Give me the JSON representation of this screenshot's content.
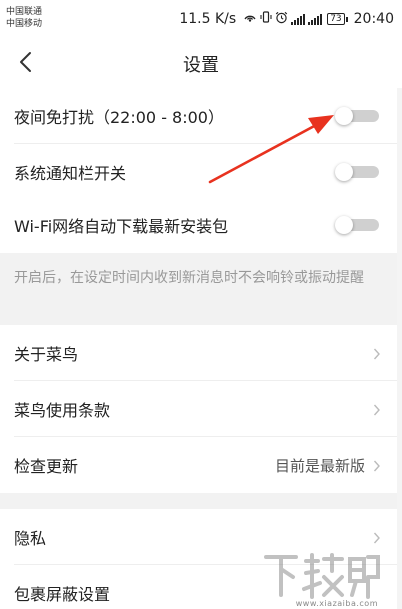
{
  "status_bar": {
    "carrier_1": "中国联通",
    "carrier_2": "中国移动",
    "net_speed": "11.5 K/s",
    "battery": "73",
    "time": "20:40",
    "icons": [
      "hotspot-icon",
      "vibrate-icon",
      "alarm-icon",
      "signal-icon",
      "signal-icon",
      "battery-icon"
    ]
  },
  "nav": {
    "title": "设置",
    "back_icon": "chevron-left-icon"
  },
  "toggles": [
    {
      "label": "夜间免打扰（22:00 - 8:00）",
      "on": false
    },
    {
      "label": "系统通知栏开关",
      "on": false
    },
    {
      "label": "Wi-Fi网络自动下载最新安装包",
      "on": false
    }
  ],
  "note": "开启后，在设定时间内收到新消息时不会响铃或振动提醒",
  "links": [
    {
      "label": "关于菜鸟",
      "value": ""
    },
    {
      "label": "菜鸟使用条款",
      "value": ""
    },
    {
      "label": "检查更新",
      "value": "目前是最新版"
    },
    {
      "label": "隐私",
      "value": ""
    },
    {
      "label": "包裹屏蔽设置",
      "value": ""
    }
  ],
  "colors": {
    "arrow": "#e8321f",
    "switch_track": "#d0d0d0",
    "note_text": "#999999",
    "section_bg": "#f2f2f2"
  },
  "watermark": {
    "logo_text": "下载吧",
    "url": "www.xiazaiba.com"
  }
}
